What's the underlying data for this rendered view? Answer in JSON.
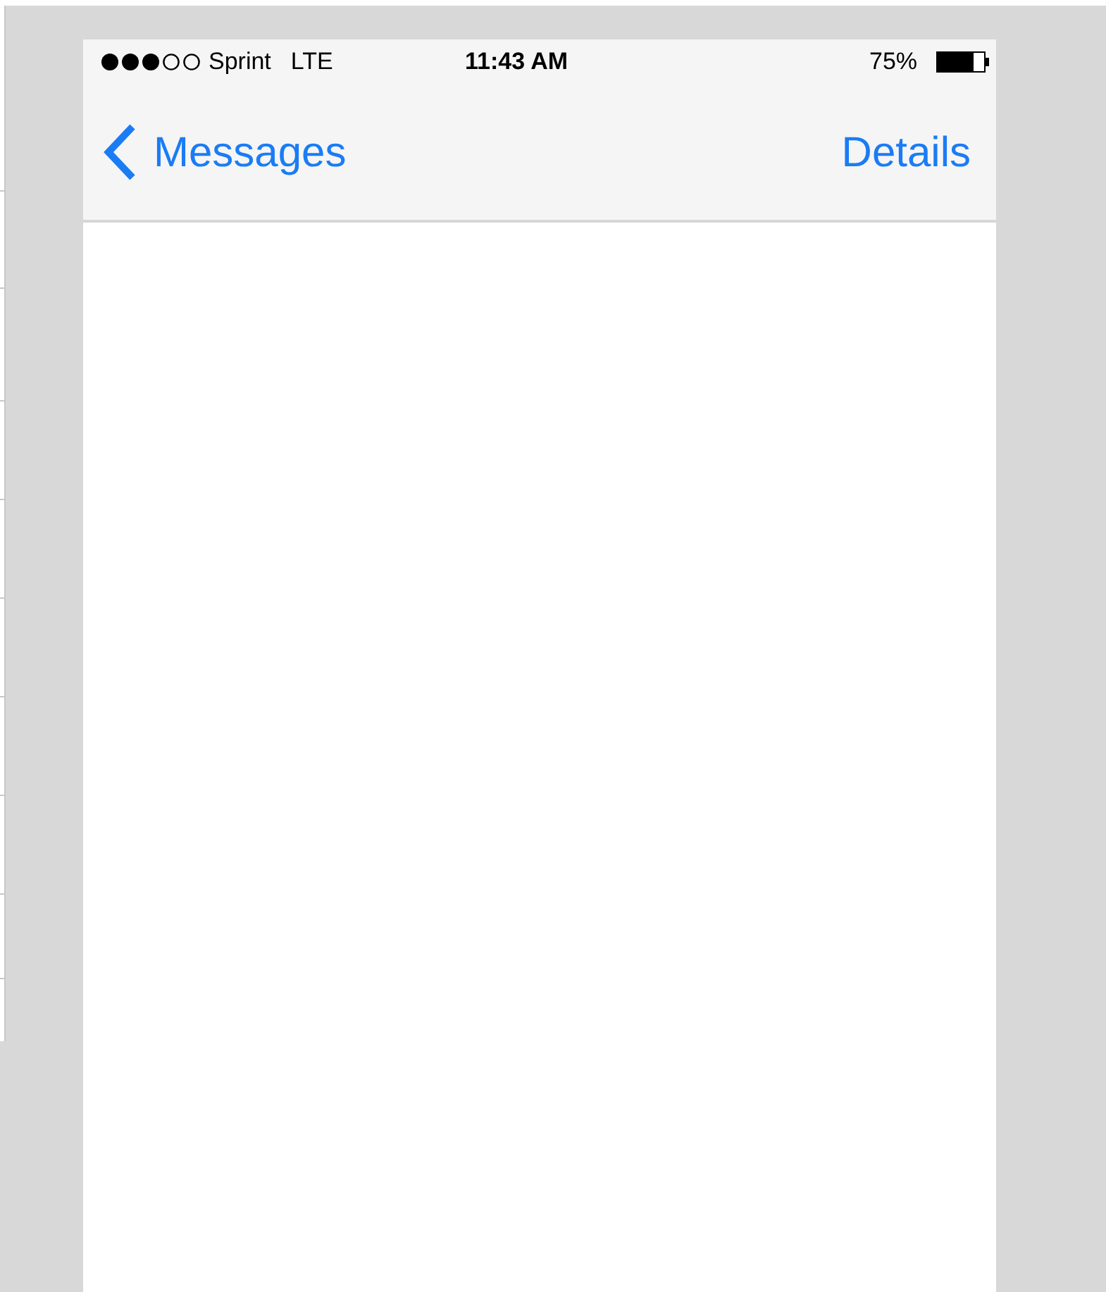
{
  "status_bar": {
    "carrier": "Sprint",
    "network": "LTE",
    "time": "11:43 AM",
    "battery": "75%"
  },
  "nav_bar": {
    "back": "Messages",
    "action": "Details"
  }
}
